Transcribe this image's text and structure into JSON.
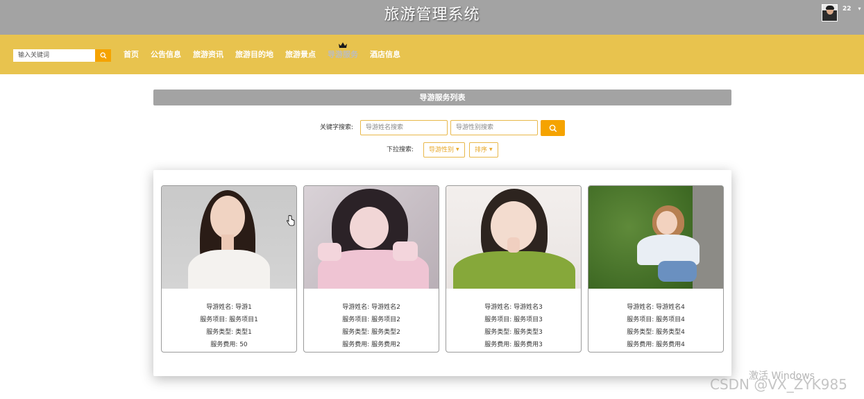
{
  "header": {
    "title": "旅游管理系统",
    "user_name": "22",
    "user_caret": "▾"
  },
  "navbar": {
    "search_placeholder": "输入关键词",
    "items": [
      {
        "label": "首页"
      },
      {
        "label": "公告信息"
      },
      {
        "label": "旅游资讯"
      },
      {
        "label": "旅游目的地"
      },
      {
        "label": "旅游景点"
      },
      {
        "label": "导游服务",
        "active": true
      },
      {
        "label": "酒店信息"
      }
    ],
    "accent_color": "#e8c34e",
    "button_color": "#f5a300"
  },
  "list": {
    "title": "导游服务列表",
    "keyword_label": "关键字搜索:",
    "name_placeholder": "导游姓名搜索",
    "gender_placeholder": "导游性别搜索",
    "dropdown_label": "下拉搜索:",
    "gender_dropdown": "导游性别",
    "sort_dropdown": "排序"
  },
  "cards": [
    {
      "name": "导游姓名: 导游1",
      "item": "服务项目: 服务项目1",
      "type": "服务类型: 类型1",
      "fee": "服务费用: 50"
    },
    {
      "name": "导游姓名: 导游姓名2",
      "item": "服务项目: 服务项目2",
      "type": "服务类型: 服务类型2",
      "fee": "服务费用: 服务费用2"
    },
    {
      "name": "导游姓名: 导游姓名3",
      "item": "服务项目: 服务项目3",
      "type": "服务类型: 服务类型3",
      "fee": "服务费用: 服务费用3"
    },
    {
      "name": "导游姓名: 导游姓名4",
      "item": "服务项目: 服务项目4",
      "type": "服务类型: 服务类型4",
      "fee": "服务费用: 服务费用4"
    }
  ],
  "watermarks": {
    "windows": "激活 Windows",
    "csdn": "CSDN @VX_ZYK985"
  }
}
